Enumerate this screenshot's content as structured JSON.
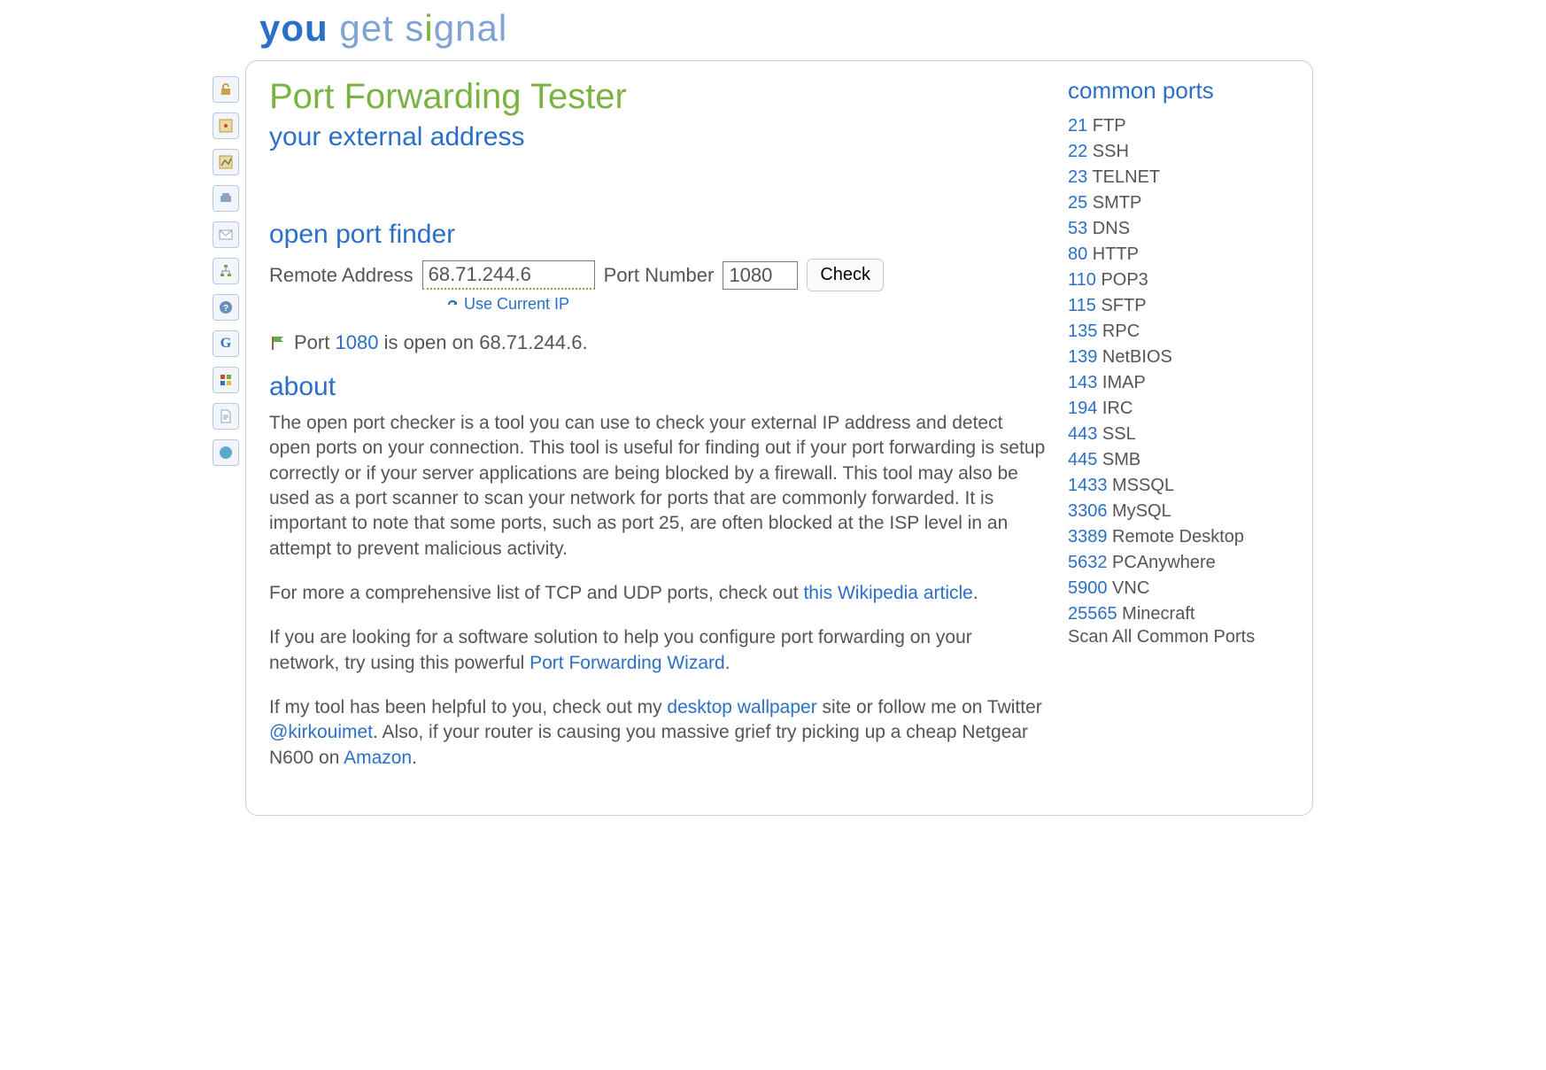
{
  "logo": {
    "you": "you",
    "get": "get",
    "signal": "signal"
  },
  "title": "Port Forwarding Tester",
  "sections": {
    "external": "your external address",
    "finder": "open port finder",
    "about": "about"
  },
  "form": {
    "remote_label": "Remote Address",
    "remote_value": "68.71.244.6",
    "port_label": "Port Number",
    "port_value": "1080",
    "check_label": "Check",
    "use_current_label": "Use Current IP"
  },
  "status": {
    "prefix": "Port",
    "port": "1080",
    "middle": "is open on",
    "ip": "68.71.244.6",
    "suffix": "."
  },
  "about_paragraphs": {
    "p1": "The open port checker is a tool you can use to check your external IP address and detect open ports on your connection. This tool is useful for finding out if your port forwarding is setup correctly or if your server applications are being blocked by a firewall. This tool may also be used as a port scanner to scan your network for ports that are commonly forwarded. It is important to note that some ports, such as port 25, are often blocked at the ISP level in an attempt to prevent malicious activity.",
    "p2_pre": "For more a comprehensive list of TCP and UDP ports, check out ",
    "p2_link": "this Wikipedia article",
    "p2_post": ".",
    "p3_pre": "If you are looking for a software solution to help you configure port forwarding on your network, try using this powerful ",
    "p3_link": "Port Forwarding Wizard",
    "p3_post": ".",
    "p4_seg1": "If my tool has been helpful to you, check out my ",
    "p4_link1": "desktop wallpaper",
    "p4_seg2": " site or follow me on Twitter ",
    "p4_link2": "@kirkouimet",
    "p4_seg3": ". Also, if your router is causing you massive grief try picking up a cheap Netgear N600 on ",
    "p4_link3": "Amazon",
    "p4_seg4": "."
  },
  "common_ports_title": "common ports",
  "common_ports": [
    {
      "port": "21",
      "name": "FTP"
    },
    {
      "port": "22",
      "name": "SSH"
    },
    {
      "port": "23",
      "name": "TELNET"
    },
    {
      "port": "25",
      "name": "SMTP"
    },
    {
      "port": "53",
      "name": "DNS"
    },
    {
      "port": "80",
      "name": "HTTP"
    },
    {
      "port": "110",
      "name": "POP3"
    },
    {
      "port": "115",
      "name": "SFTP"
    },
    {
      "port": "135",
      "name": "RPC"
    },
    {
      "port": "139",
      "name": "NetBIOS"
    },
    {
      "port": "143",
      "name": "IMAP"
    },
    {
      "port": "194",
      "name": "IRC"
    },
    {
      "port": "443",
      "name": "SSL"
    },
    {
      "port": "445",
      "name": "SMB"
    },
    {
      "port": "1433",
      "name": "MSSQL"
    },
    {
      "port": "3306",
      "name": "MySQL"
    },
    {
      "port": "3389",
      "name": "Remote Desktop"
    },
    {
      "port": "5632",
      "name": "PCAnywhere"
    },
    {
      "port": "5900",
      "name": "VNC"
    },
    {
      "port": "25565",
      "name": "Minecraft"
    }
  ],
  "scan_all_label": "Scan All Common Ports",
  "sidebar_icons": [
    "lock-open-icon",
    "map-marker-icon",
    "map-trace-icon",
    "phone-icon",
    "mail-icon",
    "network-icon",
    "help-icon",
    "google-icon",
    "windows-icon",
    "document-icon",
    "globe-icon"
  ]
}
